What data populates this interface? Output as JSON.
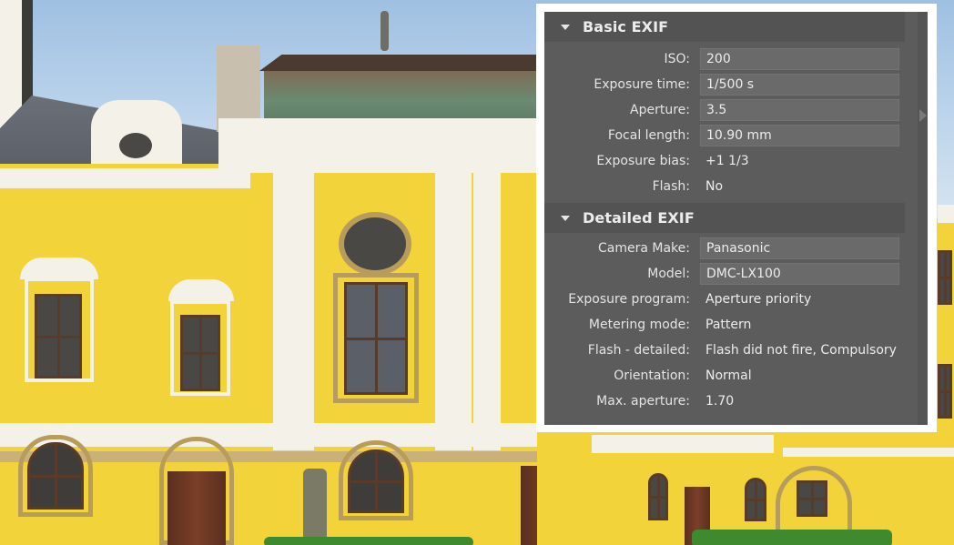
{
  "panel": {
    "sections": [
      {
        "title": "Basic EXIF",
        "expanded": true,
        "rows": [
          {
            "label": "ISO:",
            "value": "200",
            "editable": true
          },
          {
            "label": "Exposure time:",
            "value": "1/500 s",
            "editable": true
          },
          {
            "label": "Aperture:",
            "value": "3.5",
            "editable": true
          },
          {
            "label": "Focal length:",
            "value": "10.90 mm",
            "editable": true
          },
          {
            "label": "Exposure bias:",
            "value": "+1 1/3",
            "editable": false
          },
          {
            "label": "Flash:",
            "value": "No",
            "editable": false
          }
        ]
      },
      {
        "title": "Detailed EXIF",
        "expanded": true,
        "rows": [
          {
            "label": "Camera Make:",
            "value": "Panasonic",
            "editable": true
          },
          {
            "label": "Model:",
            "value": "DMC-LX100",
            "editable": true
          },
          {
            "label": "Exposure program:",
            "value": "Aperture priority",
            "editable": false
          },
          {
            "label": "Metering mode:",
            "value": "Pattern",
            "editable": false
          },
          {
            "label": "Flash - detailed:",
            "value": "Flash did not fire, Compulsory",
            "editable": false
          },
          {
            "label": "Orientation:",
            "value": "Normal",
            "editable": false
          },
          {
            "label": "Max. aperture:",
            "value": "1.70",
            "editable": false
          }
        ]
      }
    ],
    "icons": {
      "section_toggle": "triangle-down-icon",
      "side_expand": "triangle-right-icon"
    }
  },
  "colors": {
    "panel_bg": "#5c5c5c",
    "header_bg": "#535353",
    "field_bg": "#6a6a6a",
    "text": "#ececec",
    "panel_border": "#ffffff",
    "facade_yellow": "#f2d33a"
  }
}
